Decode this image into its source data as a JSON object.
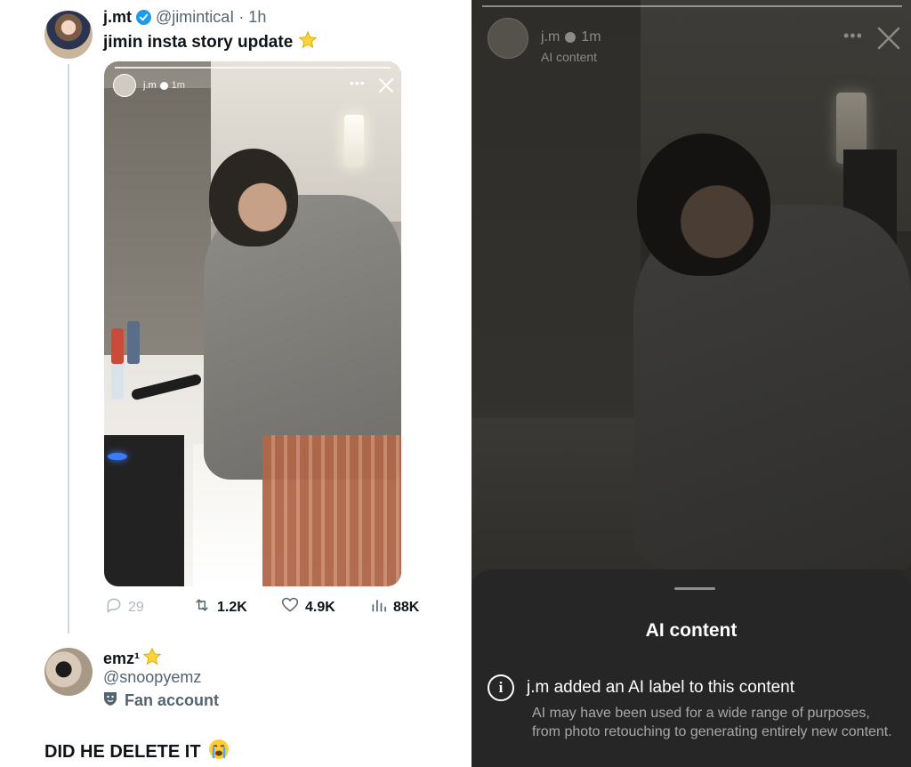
{
  "tweet": {
    "name": "j.mt",
    "handle": "@jiminticaI",
    "time": "· 1h",
    "text": "jimin insta story update",
    "story": {
      "username": "j.m",
      "time": "1m",
      "menu_icon": "more-dots-icon"
    },
    "actions": {
      "replies": "29",
      "retweets": "1.2K",
      "likes": "4.9K",
      "views": "88K"
    }
  },
  "reply": {
    "name": "emz¹",
    "handle": "@snoopyemz",
    "badge": "Fan account",
    "text": "DID HE DELETE IT"
  },
  "story_sheet": {
    "username": "j.m",
    "time": "1m",
    "subtitle": "AI content",
    "sheet_title": "AI content",
    "info_title": "j.m added an AI label to this content",
    "info_description": "AI may have been used for a wide range of purposes, from photo retouching to generating entirely new content."
  },
  "colors": {
    "verified": "#1d9bf0",
    "text_primary": "#0f1419",
    "text_secondary": "#536471",
    "sheet_bg": "#262626"
  }
}
